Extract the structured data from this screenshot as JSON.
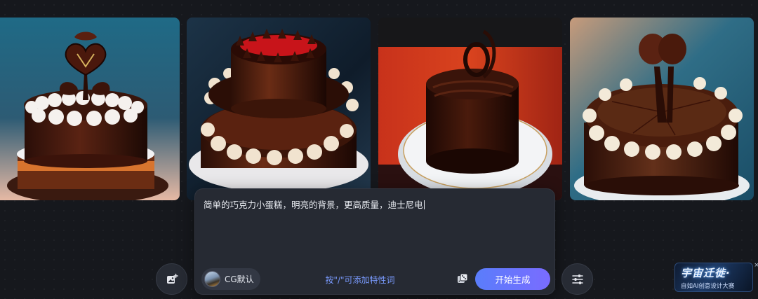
{
  "gallery": {
    "images": [
      {
        "alt": "巧克力蛋糕 1"
      },
      {
        "alt": "巧克力蛋糕 2"
      },
      {
        "alt": "巧克力蛋糕 3"
      },
      {
        "alt": "巧克力蛋糕 4"
      }
    ]
  },
  "prompt": {
    "text": "简单的巧克力小蛋糕，明亮的背景，更高质量，迪士尼电"
  },
  "toolbar": {
    "model_label": "CG默认",
    "hint": "按\"/\"可添加特性词",
    "generate_label": "开始生成"
  },
  "icons": {
    "image_upload": "image-plus-icon",
    "dice": "dice-icon",
    "settings": "sliders-icon"
  },
  "ad": {
    "title": "宇宙迁徙·",
    "subtitle": "自如AI创意设计大赛",
    "close": "×"
  },
  "colors": {
    "background": "#16181d",
    "panel": "#262a33",
    "accent_start": "#5a7dfb",
    "accent_end": "#7a6cff",
    "hint": "#7a9bff"
  }
}
